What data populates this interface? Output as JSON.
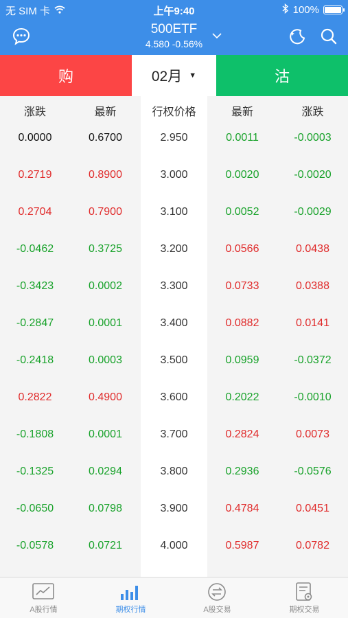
{
  "status_bar": {
    "carrier": "无 SIM 卡",
    "time": "上午9:40",
    "battery": "100%"
  },
  "nav": {
    "title": "500ETF",
    "subtitle": "4.580 -0.56%"
  },
  "tabs": {
    "buy": "购",
    "month": "02月",
    "sell": "沽"
  },
  "table": {
    "headers": [
      "涨跌",
      "最新",
      "行权价格",
      "最新",
      "涨跌"
    ],
    "rows": [
      {
        "call_change": "0.0000",
        "call_last": "0.6700",
        "strike": "2.950",
        "put_last": "0.0011",
        "put_change": "-0.0003"
      },
      {
        "call_change": "0.2719",
        "call_last": "0.8900",
        "strike": "3.000",
        "put_last": "0.0020",
        "put_change": "-0.0020"
      },
      {
        "call_change": "0.2704",
        "call_last": "0.7900",
        "strike": "3.100",
        "put_last": "0.0052",
        "put_change": "-0.0029"
      },
      {
        "call_change": "-0.0462",
        "call_last": "0.3725",
        "strike": "3.200",
        "put_last": "0.0566",
        "put_change": "0.0438"
      },
      {
        "call_change": "-0.3423",
        "call_last": "0.0002",
        "strike": "3.300",
        "put_last": "0.0733",
        "put_change": "0.0388"
      },
      {
        "call_change": "-0.2847",
        "call_last": "0.0001",
        "strike": "3.400",
        "put_last": "0.0882",
        "put_change": "0.0141"
      },
      {
        "call_change": "-0.2418",
        "call_last": "0.0003",
        "strike": "3.500",
        "put_last": "0.0959",
        "put_change": "-0.0372"
      },
      {
        "call_change": "0.2822",
        "call_last": "0.4900",
        "strike": "3.600",
        "put_last": "0.2022",
        "put_change": "-0.0010"
      },
      {
        "call_change": "-0.1808",
        "call_last": "0.0001",
        "strike": "3.700",
        "put_last": "0.2824",
        "put_change": "0.0073"
      },
      {
        "call_change": "-0.1325",
        "call_last": "0.0294",
        "strike": "3.800",
        "put_last": "0.2936",
        "put_change": "-0.0576"
      },
      {
        "call_change": "-0.0650",
        "call_last": "0.0798",
        "strike": "3.900",
        "put_last": "0.4784",
        "put_change": "0.0451"
      },
      {
        "call_change": "-0.0578",
        "call_last": "0.0721",
        "strike": "4.000",
        "put_last": "0.5987",
        "put_change": "0.0782"
      }
    ]
  },
  "tabbar": {
    "items": [
      {
        "label": "A股行情",
        "icon": "stock-chart-icon"
      },
      {
        "label": "期权行情",
        "icon": "bar-chart-icon"
      },
      {
        "label": "A股交易",
        "icon": "exchange-icon"
      },
      {
        "label": "期权交易",
        "icon": "document-icon"
      }
    ],
    "active_index": 1
  },
  "colors": {
    "brand_blue": "#3d8ee8",
    "buy_red": "#fc4545",
    "sell_green": "#0ec06a",
    "up_red": "#e02a2a",
    "down_green": "#18a22a"
  }
}
